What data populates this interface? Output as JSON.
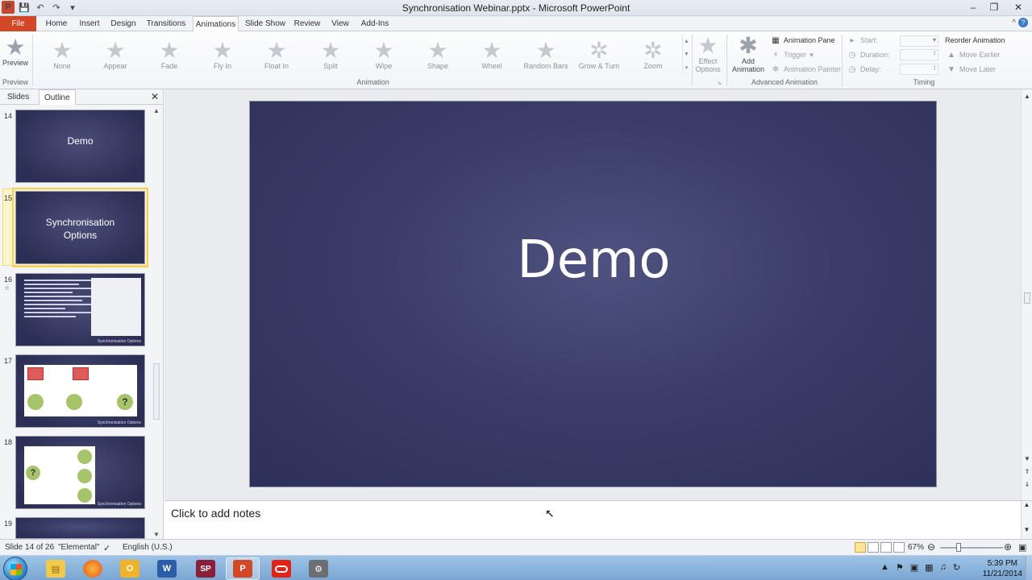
{
  "window": {
    "title": "Synchronisation Webinar.pptx - Microsoft PowerPoint"
  },
  "tabs": [
    {
      "label": "File"
    },
    {
      "label": "Home"
    },
    {
      "label": "Insert"
    },
    {
      "label": "Design"
    },
    {
      "label": "Transitions"
    },
    {
      "label": "Animations"
    },
    {
      "label": "Slide Show"
    },
    {
      "label": "Review"
    },
    {
      "label": "View"
    },
    {
      "label": "Add-Ins"
    }
  ],
  "ribbon": {
    "preview": {
      "label": "Preview",
      "group": "Preview"
    },
    "animations": [
      "None",
      "Appear",
      "Fade",
      "Fly In",
      "Float In",
      "Split",
      "Wipe",
      "Shape",
      "Wheel",
      "Random Bars",
      "Grow & Turn",
      "Zoom"
    ],
    "animation_group": "Animation",
    "effect_options": [
      "Effect",
      "Options"
    ],
    "add_animation": [
      "Add",
      "Animation"
    ],
    "advanced": {
      "animation_pane": "Animation Pane",
      "trigger": "Trigger",
      "animation_painter": "Animation Painter",
      "group": "Advanced Animation"
    },
    "timing": {
      "start": "Start:",
      "duration": "Duration:",
      "delay": "Delay:",
      "reorder": "Reorder Animation",
      "move_earlier": "Move Earlier",
      "move_later": "Move Later",
      "group": "Timing"
    }
  },
  "panel": {
    "tabs": [
      "Slides",
      "Outline"
    ],
    "slides": [
      {
        "num": "14",
        "title": "Demo"
      },
      {
        "num": "15",
        "title": "Synchronisation Options"
      },
      {
        "num": "16",
        "footer": "Synchronisation Options"
      },
      {
        "num": "17",
        "footer": "Synchronisation Options"
      },
      {
        "num": "18",
        "footer": "Synchronisation Options"
      },
      {
        "num": "19"
      }
    ]
  },
  "slide": {
    "title": "Demo"
  },
  "notes": {
    "placeholder": "Click to add notes"
  },
  "status": {
    "slide": "Slide 14 of 26",
    "theme": "\"Elemental\"",
    "language": "English (U.S.)",
    "zoom": "67%"
  },
  "taskbar": {
    "apps": [
      "explorer",
      "firefox",
      "outlook",
      "word",
      "sharepoint",
      "powerpoint",
      "oracle",
      "tool"
    ],
    "time": "5:39 PM",
    "date": "11/21/2014"
  }
}
